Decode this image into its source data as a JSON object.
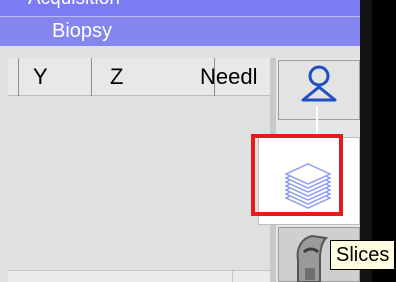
{
  "window": {
    "title_partial": "Acquisition"
  },
  "tab": {
    "title": "Biopsy"
  },
  "table": {
    "columns": [
      "Y",
      "Z",
      "Needl"
    ]
  },
  "tools": {
    "items": [
      {
        "icon": "person-icon",
        "state": "normal"
      },
      {
        "icon": "slices-icon",
        "state": "highlighted"
      },
      {
        "icon": "gray-tool-icon",
        "state": "normal"
      }
    ]
  },
  "tooltip": {
    "text": "Slices"
  },
  "colors": {
    "header": "#8585f0",
    "highlight": "#e51a1a",
    "tooltip_bg": "#fffde1",
    "icon_blue": "#1f4fc1",
    "slices_blue": "#8c9cf5"
  }
}
